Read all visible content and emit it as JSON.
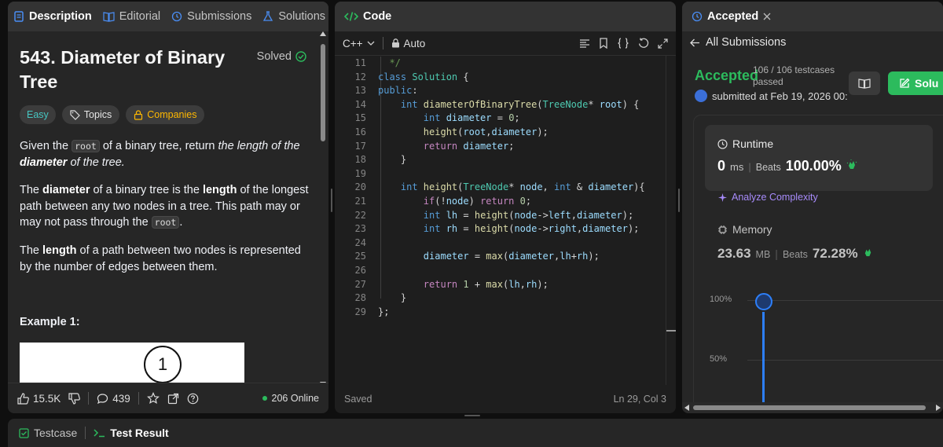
{
  "left": {
    "tabs": [
      {
        "label": "Description",
        "icon": "description-icon"
      },
      {
        "label": "Editorial",
        "icon": "book-open-icon"
      },
      {
        "label": "Submissions",
        "icon": "history-icon"
      },
      {
        "label": "Solutions",
        "icon": "flask-icon"
      }
    ],
    "title": "543. Diameter of Binary Tree",
    "solved_label": "Solved",
    "difficulty": "Easy",
    "topics_label": "Topics",
    "companies_label": "Companies",
    "para1": {
      "a": "Given the ",
      "code": "root",
      "b": " of a binary tree, return ",
      "em": "the length of the ",
      "emb": "diameter",
      "em2": " of the tree."
    },
    "para2": {
      "a": "The ",
      "b1": "diameter",
      "c": " of a binary tree is the ",
      "b2": "length",
      "d": " of the longest path between any two nodes in a tree. This path may or may not pass through the ",
      "code": "root",
      "e": "."
    },
    "para3": {
      "a": "The ",
      "b1": "length",
      "c": " of a path between two nodes is represented by the number of edges between them."
    },
    "example_label": "Example 1:",
    "example_node": "1",
    "footer": {
      "likes": "15.5K",
      "comments": "439",
      "online": "206 Online"
    }
  },
  "code": {
    "tab_label": "Code",
    "language": "C++",
    "auto_label": "Auto",
    "status_left": "Saved",
    "status_right": "Ln 29, Col 3",
    "lines": [
      {
        "n": "11",
        "tokens": [
          {
            "t": "  */",
            "c": "cm"
          }
        ]
      },
      {
        "n": "12",
        "tokens": [
          {
            "t": "class ",
            "c": "kw"
          },
          {
            "t": "Solution ",
            "c": "ty"
          },
          {
            "t": "{",
            "c": ""
          }
        ]
      },
      {
        "n": "13",
        "tokens": [
          {
            "t": "public",
            "c": "kw"
          },
          {
            "t": ":",
            "c": ""
          }
        ]
      },
      {
        "n": "14",
        "tokens": [
          {
            "t": "    int ",
            "c": "kw"
          },
          {
            "t": "diameterOfBinaryTree",
            "c": "fn"
          },
          {
            "t": "(",
            "c": ""
          },
          {
            "t": "TreeNode",
            "c": "ty"
          },
          {
            "t": "* ",
            "c": ""
          },
          {
            "t": "root",
            "c": "var"
          },
          {
            "t": ") {",
            "c": ""
          }
        ]
      },
      {
        "n": "15",
        "tokens": [
          {
            "t": "        int ",
            "c": "kw"
          },
          {
            "t": "diameter",
            "c": "var"
          },
          {
            "t": " = ",
            "c": ""
          },
          {
            "t": "0",
            "c": "num"
          },
          {
            "t": ";",
            "c": ""
          }
        ]
      },
      {
        "n": "16",
        "tokens": [
          {
            "t": "        height",
            "c": "fn"
          },
          {
            "t": "(",
            "c": ""
          },
          {
            "t": "root",
            "c": "var"
          },
          {
            "t": ",",
            "c": ""
          },
          {
            "t": "diameter",
            "c": "var"
          },
          {
            "t": ");",
            "c": ""
          }
        ]
      },
      {
        "n": "17",
        "tokens": [
          {
            "t": "        return ",
            "c": "ctl"
          },
          {
            "t": "diameter",
            "c": "var"
          },
          {
            "t": ";",
            "c": ""
          }
        ]
      },
      {
        "n": "18",
        "tokens": [
          {
            "t": "    }",
            "c": ""
          }
        ]
      },
      {
        "n": "19",
        "tokens": []
      },
      {
        "n": "20",
        "tokens": [
          {
            "t": "    int ",
            "c": "kw"
          },
          {
            "t": "height",
            "c": "fn"
          },
          {
            "t": "(",
            "c": ""
          },
          {
            "t": "TreeNode",
            "c": "ty"
          },
          {
            "t": "* ",
            "c": ""
          },
          {
            "t": "node",
            "c": "var"
          },
          {
            "t": ", ",
            "c": ""
          },
          {
            "t": "int",
            "c": "kw"
          },
          {
            "t": " & ",
            "c": ""
          },
          {
            "t": "diameter",
            "c": "var"
          },
          {
            "t": "){",
            "c": ""
          }
        ]
      },
      {
        "n": "21",
        "tokens": [
          {
            "t": "        if",
            "c": "ctl"
          },
          {
            "t": "(!",
            "c": ""
          },
          {
            "t": "node",
            "c": "var"
          },
          {
            "t": ") ",
            "c": ""
          },
          {
            "t": "return ",
            "c": "ctl"
          },
          {
            "t": "0",
            "c": "num"
          },
          {
            "t": ";",
            "c": ""
          }
        ]
      },
      {
        "n": "22",
        "tokens": [
          {
            "t": "        int ",
            "c": "kw"
          },
          {
            "t": "lh",
            "c": "var"
          },
          {
            "t": " = ",
            "c": ""
          },
          {
            "t": "height",
            "c": "fn"
          },
          {
            "t": "(",
            "c": ""
          },
          {
            "t": "node",
            "c": "var"
          },
          {
            "t": "->",
            "c": ""
          },
          {
            "t": "left",
            "c": "var"
          },
          {
            "t": ",",
            "c": ""
          },
          {
            "t": "diameter",
            "c": "var"
          },
          {
            "t": ");",
            "c": ""
          }
        ]
      },
      {
        "n": "23",
        "tokens": [
          {
            "t": "        int ",
            "c": "kw"
          },
          {
            "t": "rh",
            "c": "var"
          },
          {
            "t": " = ",
            "c": ""
          },
          {
            "t": "height",
            "c": "fn"
          },
          {
            "t": "(",
            "c": ""
          },
          {
            "t": "node",
            "c": "var"
          },
          {
            "t": "->",
            "c": ""
          },
          {
            "t": "right",
            "c": "var"
          },
          {
            "t": ",",
            "c": ""
          },
          {
            "t": "diameter",
            "c": "var"
          },
          {
            "t": ");",
            "c": ""
          }
        ]
      },
      {
        "n": "24",
        "tokens": []
      },
      {
        "n": "25",
        "tokens": [
          {
            "t": "        diameter",
            "c": "var"
          },
          {
            "t": " = ",
            "c": ""
          },
          {
            "t": "max",
            "c": "fn"
          },
          {
            "t": "(",
            "c": ""
          },
          {
            "t": "diameter",
            "c": "var"
          },
          {
            "t": ",",
            "c": ""
          },
          {
            "t": "lh",
            "c": "var"
          },
          {
            "t": "+",
            "c": ""
          },
          {
            "t": "rh",
            "c": "var"
          },
          {
            "t": ");",
            "c": ""
          }
        ]
      },
      {
        "n": "26",
        "tokens": []
      },
      {
        "n": "27",
        "tokens": [
          {
            "t": "        return ",
            "c": "ctl"
          },
          {
            "t": "1",
            "c": "num"
          },
          {
            "t": " + ",
            "c": ""
          },
          {
            "t": "max",
            "c": "fn"
          },
          {
            "t": "(",
            "c": ""
          },
          {
            "t": "lh",
            "c": "var"
          },
          {
            "t": ",",
            "c": ""
          },
          {
            "t": "rh",
            "c": "var"
          },
          {
            "t": ");",
            "c": ""
          }
        ]
      },
      {
        "n": "28",
        "tokens": [
          {
            "t": "    }",
            "c": ""
          }
        ]
      },
      {
        "n": "29",
        "tokens": [
          {
            "t": "};",
            "c": ""
          }
        ]
      }
    ]
  },
  "right": {
    "tab_label": "Accepted",
    "back_label": "All Submissions",
    "status": "Accepted",
    "testcases": "106 / 106 testcases",
    "passed": "passed",
    "submitted": "submitted at Feb 19, 2026 00:",
    "solution_btn": "Solu",
    "runtime_label": "Runtime",
    "runtime_value": "0",
    "runtime_unit": "ms",
    "beats_label": "Beats",
    "runtime_pct": "100.00%",
    "analyze_label": "Analyze Complexity",
    "memory_label": "Memory",
    "memory_value": "23.63",
    "memory_unit": "MB",
    "memory_pct": "72.28%",
    "chart_ticks": [
      "100%",
      "50%"
    ]
  },
  "bottom": {
    "testcase_label": "Testcase",
    "result_label": "Test Result"
  },
  "colors": {
    "accent_green": "#2cbb5d",
    "easy": "#46c6c2",
    "companies": "#ffb800",
    "link_blue": "#2d7ff9"
  }
}
